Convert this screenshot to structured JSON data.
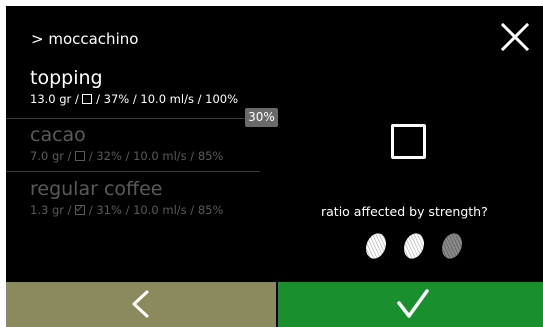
{
  "header": {
    "breadcrumb": "> moccachino"
  },
  "ingredients": [
    {
      "name": "topping",
      "weight": "13.0 gr",
      "checked": false,
      "ratio": "37%",
      "flow": "10.0 ml/s",
      "strength": "100%",
      "active": true
    },
    {
      "name": "cacao",
      "weight": "7.0 gr",
      "checked": false,
      "ratio": "32%",
      "flow": "10.0 ml/s",
      "strength": "85%",
      "active": false
    },
    {
      "name": "regular coffee",
      "weight": "1.3 gr",
      "checked": true,
      "ratio": "31%",
      "flow": "10.0 ml/s",
      "strength": "85%",
      "active": false
    }
  ],
  "level_badge": "30%",
  "option": {
    "label": "ratio affected by strength?",
    "checked": false
  },
  "strength_icons": [
    "strength-bean-icon",
    "strength-bean-icon",
    "strength-bean-icon"
  ],
  "colors": {
    "background": "#000000",
    "back_bar": "#8b8a5e",
    "confirm_bar": "#1a8f2e",
    "dim_text": "#5a5a5a",
    "badge": "#6a6a6a"
  },
  "icons": {
    "close": "close-icon",
    "back": "chevron-left-icon",
    "confirm": "checkmark-icon"
  }
}
